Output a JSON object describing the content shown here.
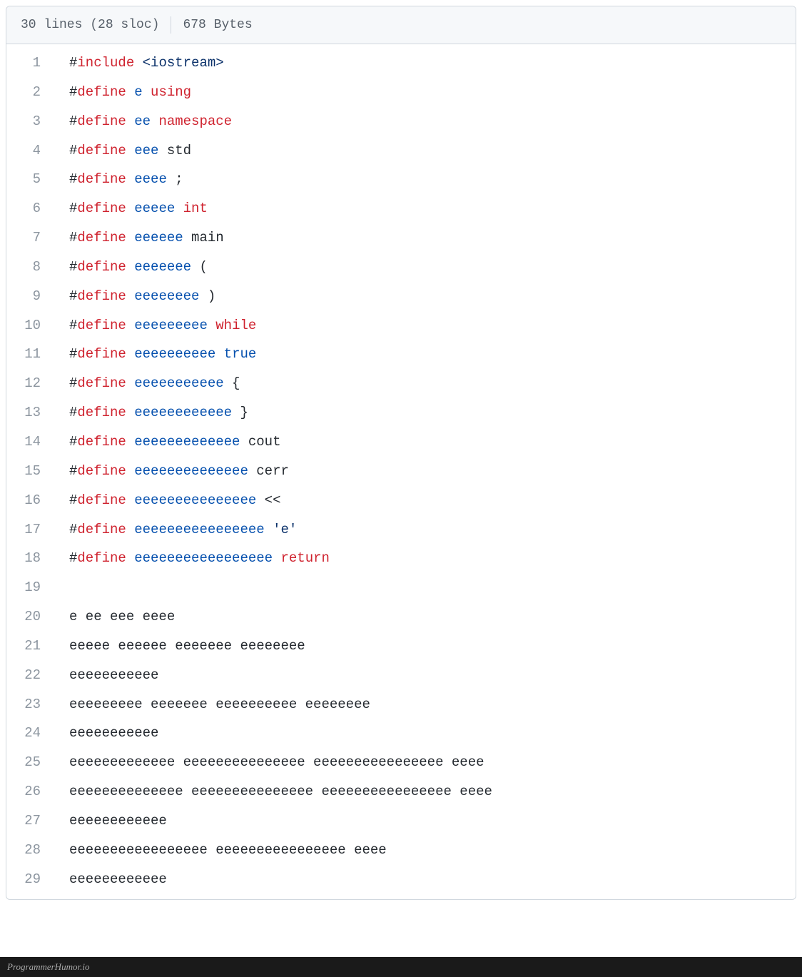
{
  "header": {
    "lines_text": "30 lines (28 sloc)",
    "bytes_text": "678 Bytes"
  },
  "footer": {
    "watermark": "ProgrammerHumor.io"
  },
  "code": {
    "lines": [
      {
        "n": "1",
        "tokens": [
          {
            "c": "tok-plain",
            "t": "#"
          },
          {
            "c": "tok-pre",
            "t": "include"
          },
          {
            "c": "tok-plain",
            "t": " "
          },
          {
            "c": "tok-header",
            "t": "<iostream>"
          }
        ]
      },
      {
        "n": "2",
        "tokens": [
          {
            "c": "tok-plain",
            "t": "#"
          },
          {
            "c": "tok-pre",
            "t": "define"
          },
          {
            "c": "tok-plain",
            "t": " "
          },
          {
            "c": "tok-prename",
            "t": "e"
          },
          {
            "c": "tok-plain",
            "t": " "
          },
          {
            "c": "tok-keyword",
            "t": "using"
          }
        ]
      },
      {
        "n": "3",
        "tokens": [
          {
            "c": "tok-plain",
            "t": "#"
          },
          {
            "c": "tok-pre",
            "t": "define"
          },
          {
            "c": "tok-plain",
            "t": " "
          },
          {
            "c": "tok-prename",
            "t": "ee"
          },
          {
            "c": "tok-plain",
            "t": " "
          },
          {
            "c": "tok-keyword",
            "t": "namespace"
          }
        ]
      },
      {
        "n": "4",
        "tokens": [
          {
            "c": "tok-plain",
            "t": "#"
          },
          {
            "c": "tok-pre",
            "t": "define"
          },
          {
            "c": "tok-plain",
            "t": " "
          },
          {
            "c": "tok-prename",
            "t": "eee"
          },
          {
            "c": "tok-plain",
            "t": " std"
          }
        ]
      },
      {
        "n": "5",
        "tokens": [
          {
            "c": "tok-plain",
            "t": "#"
          },
          {
            "c": "tok-pre",
            "t": "define"
          },
          {
            "c": "tok-plain",
            "t": " "
          },
          {
            "c": "tok-prename",
            "t": "eeee"
          },
          {
            "c": "tok-plain",
            "t": " ;"
          }
        ]
      },
      {
        "n": "6",
        "tokens": [
          {
            "c": "tok-plain",
            "t": "#"
          },
          {
            "c": "tok-pre",
            "t": "define"
          },
          {
            "c": "tok-plain",
            "t": " "
          },
          {
            "c": "tok-prename",
            "t": "eeeee"
          },
          {
            "c": "tok-plain",
            "t": " "
          },
          {
            "c": "tok-type",
            "t": "int"
          }
        ]
      },
      {
        "n": "7",
        "tokens": [
          {
            "c": "tok-plain",
            "t": "#"
          },
          {
            "c": "tok-pre",
            "t": "define"
          },
          {
            "c": "tok-plain",
            "t": " "
          },
          {
            "c": "tok-prename",
            "t": "eeeeee"
          },
          {
            "c": "tok-plain",
            "t": " main"
          }
        ]
      },
      {
        "n": "8",
        "tokens": [
          {
            "c": "tok-plain",
            "t": "#"
          },
          {
            "c": "tok-pre",
            "t": "define"
          },
          {
            "c": "tok-plain",
            "t": " "
          },
          {
            "c": "tok-prename",
            "t": "eeeeeee"
          },
          {
            "c": "tok-plain",
            "t": " ("
          }
        ]
      },
      {
        "n": "9",
        "tokens": [
          {
            "c": "tok-plain",
            "t": "#"
          },
          {
            "c": "tok-pre",
            "t": "define"
          },
          {
            "c": "tok-plain",
            "t": " "
          },
          {
            "c": "tok-prename",
            "t": "eeeeeeee"
          },
          {
            "c": "tok-plain",
            "t": " )"
          }
        ]
      },
      {
        "n": "10",
        "tokens": [
          {
            "c": "tok-plain",
            "t": "#"
          },
          {
            "c": "tok-pre",
            "t": "define"
          },
          {
            "c": "tok-plain",
            "t": " "
          },
          {
            "c": "tok-prename",
            "t": "eeeeeeeee"
          },
          {
            "c": "tok-plain",
            "t": " "
          },
          {
            "c": "tok-keyword",
            "t": "while"
          }
        ]
      },
      {
        "n": "11",
        "tokens": [
          {
            "c": "tok-plain",
            "t": "#"
          },
          {
            "c": "tok-pre",
            "t": "define"
          },
          {
            "c": "tok-plain",
            "t": " "
          },
          {
            "c": "tok-prename",
            "t": "eeeeeeeeee"
          },
          {
            "c": "tok-plain",
            "t": " "
          },
          {
            "c": "tok-bool",
            "t": "true"
          }
        ]
      },
      {
        "n": "12",
        "tokens": [
          {
            "c": "tok-plain",
            "t": "#"
          },
          {
            "c": "tok-pre",
            "t": "define"
          },
          {
            "c": "tok-plain",
            "t": " "
          },
          {
            "c": "tok-prename",
            "t": "eeeeeeeeeee"
          },
          {
            "c": "tok-plain",
            "t": " {"
          }
        ]
      },
      {
        "n": "13",
        "tokens": [
          {
            "c": "tok-plain",
            "t": "#"
          },
          {
            "c": "tok-pre",
            "t": "define"
          },
          {
            "c": "tok-plain",
            "t": " "
          },
          {
            "c": "tok-prename",
            "t": "eeeeeeeeeeee"
          },
          {
            "c": "tok-plain",
            "t": " }"
          }
        ]
      },
      {
        "n": "14",
        "tokens": [
          {
            "c": "tok-plain",
            "t": "#"
          },
          {
            "c": "tok-pre",
            "t": "define"
          },
          {
            "c": "tok-plain",
            "t": " "
          },
          {
            "c": "tok-prename",
            "t": "eeeeeeeeeeeee"
          },
          {
            "c": "tok-plain",
            "t": " cout"
          }
        ]
      },
      {
        "n": "15",
        "tokens": [
          {
            "c": "tok-plain",
            "t": "#"
          },
          {
            "c": "tok-pre",
            "t": "define"
          },
          {
            "c": "tok-plain",
            "t": " "
          },
          {
            "c": "tok-prename",
            "t": "eeeeeeeeeeeeee"
          },
          {
            "c": "tok-plain",
            "t": " cerr"
          }
        ]
      },
      {
        "n": "16",
        "tokens": [
          {
            "c": "tok-plain",
            "t": "#"
          },
          {
            "c": "tok-pre",
            "t": "define"
          },
          {
            "c": "tok-plain",
            "t": " "
          },
          {
            "c": "tok-prename",
            "t": "eeeeeeeeeeeeeee"
          },
          {
            "c": "tok-plain",
            "t": " <<"
          }
        ]
      },
      {
        "n": "17",
        "tokens": [
          {
            "c": "tok-plain",
            "t": "#"
          },
          {
            "c": "tok-pre",
            "t": "define"
          },
          {
            "c": "tok-plain",
            "t": " "
          },
          {
            "c": "tok-prename",
            "t": "eeeeeeeeeeeeeeee"
          },
          {
            "c": "tok-plain",
            "t": " "
          },
          {
            "c": "tok-char",
            "t": "'e'"
          }
        ]
      },
      {
        "n": "18",
        "tokens": [
          {
            "c": "tok-plain",
            "t": "#"
          },
          {
            "c": "tok-pre",
            "t": "define"
          },
          {
            "c": "tok-plain",
            "t": " "
          },
          {
            "c": "tok-prename",
            "t": "eeeeeeeeeeeeeeeee"
          },
          {
            "c": "tok-plain",
            "t": " "
          },
          {
            "c": "tok-keyword",
            "t": "return"
          }
        ]
      },
      {
        "n": "19",
        "tokens": [
          {
            "c": "tok-plain",
            "t": ""
          }
        ]
      },
      {
        "n": "20",
        "tokens": [
          {
            "c": "tok-plain",
            "t": "e ee eee eeee"
          }
        ]
      },
      {
        "n": "21",
        "tokens": [
          {
            "c": "tok-plain",
            "t": "eeeee eeeeee eeeeeee eeeeeeee"
          }
        ]
      },
      {
        "n": "22",
        "tokens": [
          {
            "c": "tok-plain",
            "t": "eeeeeeeeeee"
          }
        ]
      },
      {
        "n": "23",
        "tokens": [
          {
            "c": "tok-plain",
            "t": "eeeeeeeee eeeeeee eeeeeeeeee eeeeeeee"
          }
        ]
      },
      {
        "n": "24",
        "tokens": [
          {
            "c": "tok-plain",
            "t": "eeeeeeeeeee"
          }
        ]
      },
      {
        "n": "25",
        "tokens": [
          {
            "c": "tok-plain",
            "t": "eeeeeeeeeeeee eeeeeeeeeeeeeee eeeeeeeeeeeeeeee eeee"
          }
        ]
      },
      {
        "n": "26",
        "tokens": [
          {
            "c": "tok-plain",
            "t": "eeeeeeeeeeeeee eeeeeeeeeeeeeee eeeeeeeeeeeeeeee eeee"
          }
        ]
      },
      {
        "n": "27",
        "tokens": [
          {
            "c": "tok-plain",
            "t": "eeeeeeeeeeee"
          }
        ]
      },
      {
        "n": "28",
        "tokens": [
          {
            "c": "tok-plain",
            "t": "eeeeeeeeeeeeeeeee eeeeeeeeeeeeeeee eeee"
          }
        ]
      },
      {
        "n": "29",
        "tokens": [
          {
            "c": "tok-plain",
            "t": "eeeeeeeeeeee"
          }
        ]
      }
    ]
  }
}
